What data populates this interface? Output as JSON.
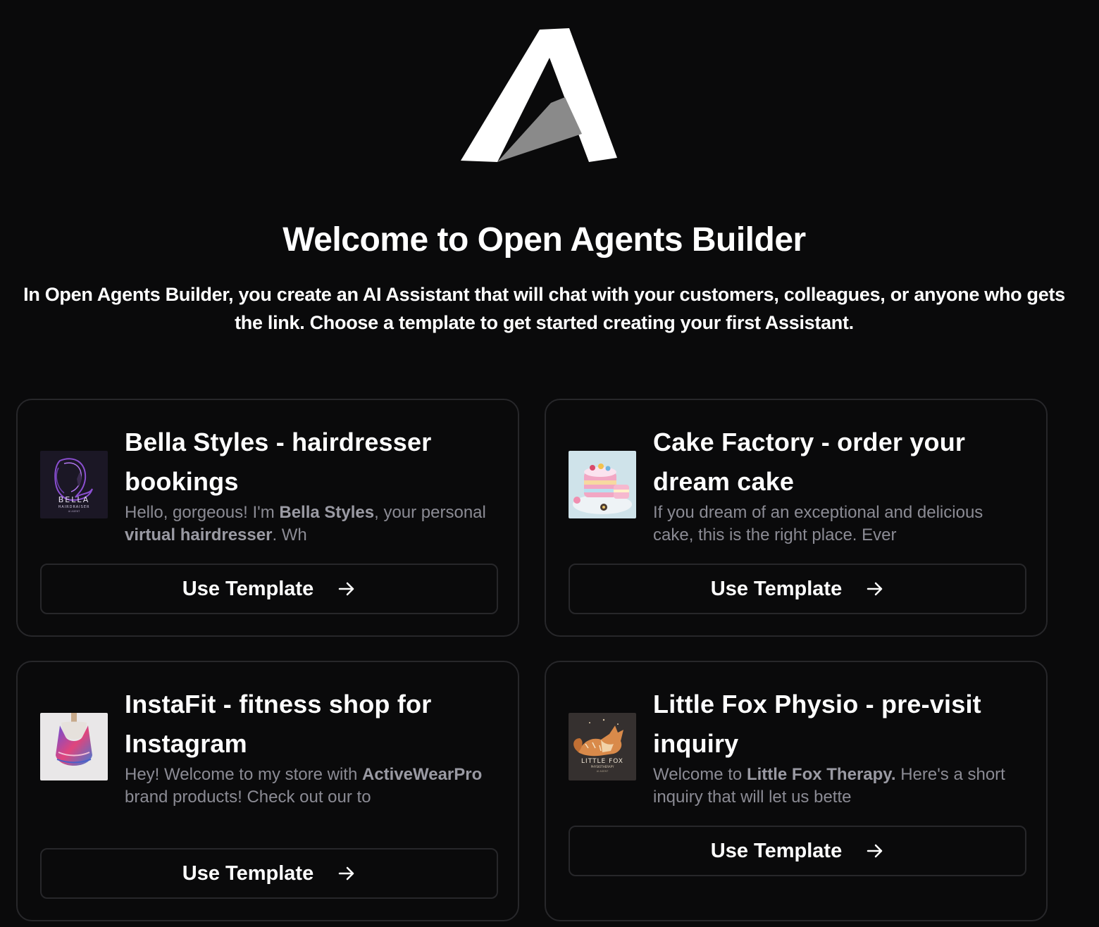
{
  "header": {
    "title": "Welcome to Open Agents Builder",
    "subtitle": "In Open Agents Builder, you create an AI Assistant that will chat with your customers, colleagues, or anyone who gets the link. Choose a template to get started creating your first Assistant."
  },
  "logo": {
    "icon": "open-agents-logo",
    "color": "#ffffff",
    "shade": "#8a8a8a"
  },
  "templates": [
    {
      "title": "Bella Styles - hairdresser bookings",
      "desc_parts": [
        "Hello, gorgeous! I'm ",
        "Bella Styles",
        ", your personal ",
        "virtual hairdresser",
        ". Wh"
      ],
      "thumb_icon": "bella-hairdresser-thumbnail",
      "thumb_text": [
        "BELLA",
        "HAIRDRAISER",
        "AI AGENT"
      ],
      "button_label": "Use Template"
    },
    {
      "title": "Cake Factory - order your dream cake",
      "desc_parts": [
        "If you dream of an exceptional and delicious cake, this is the right place. Ever"
      ],
      "thumb_icon": "cake-thumbnail",
      "button_label": "Use Template"
    },
    {
      "title": "InstaFit - fitness shop for Instagram",
      "desc_parts": [
        "Hey! Welcome to my store with ",
        "ActiveWearPro",
        " brand products! Check out our to"
      ],
      "thumb_icon": "sports-top-thumbnail",
      "button_label": "Use Template"
    },
    {
      "title": "Little Fox Physio - pre-visit inquiry",
      "desc_parts": [
        "Welcome to ",
        "Little Fox Therapy.",
        " Here's a short inquiry that will let us bette"
      ],
      "thumb_icon": "fox-physio-thumbnail",
      "thumb_text": [
        "LITTLE FOX",
        "PHYSIOTHERAPY",
        "AI AGENT"
      ],
      "button_label": "Use Template"
    }
  ],
  "colors": {
    "background": "#0a0a0b",
    "border": "#27272a",
    "muted_text": "#8b8b94"
  }
}
